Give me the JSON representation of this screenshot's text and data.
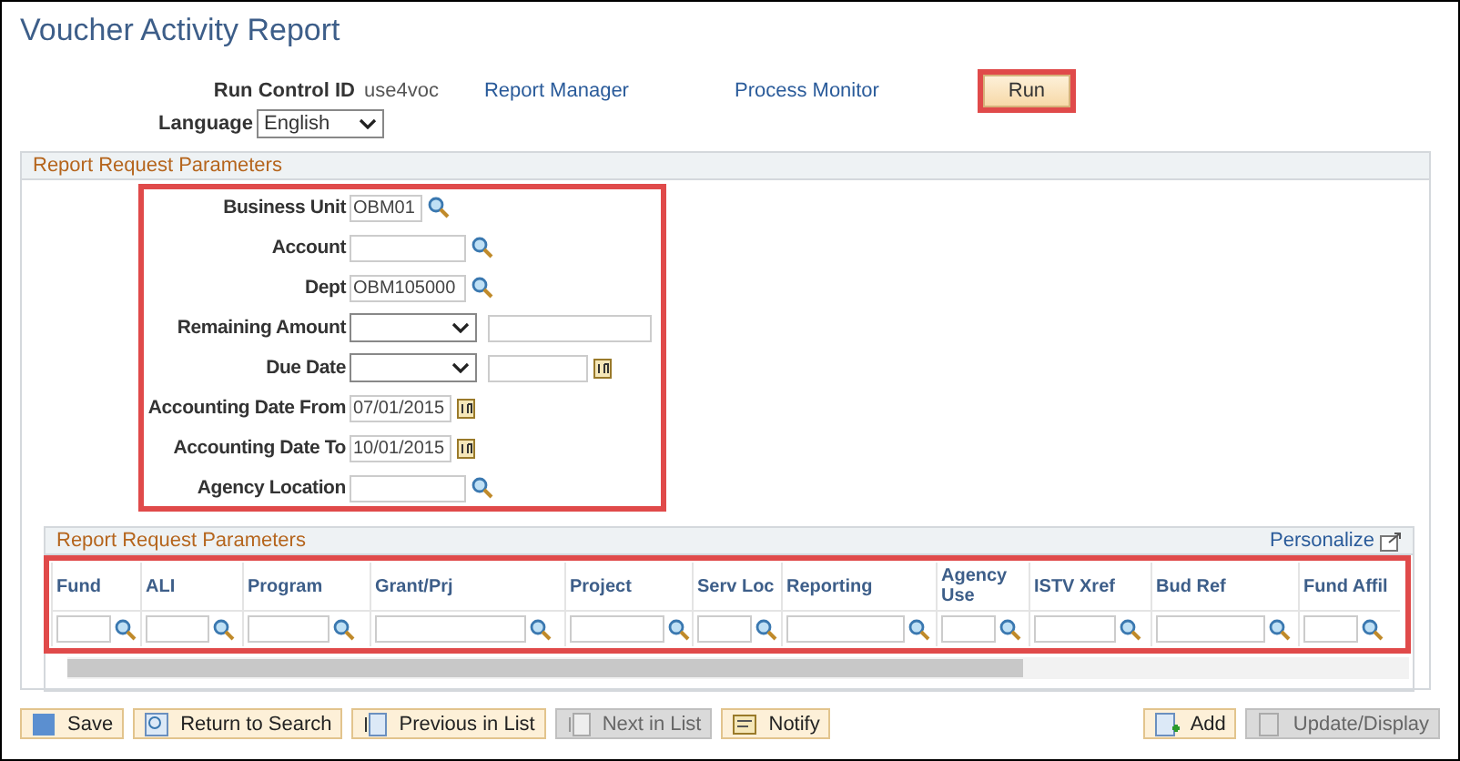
{
  "page_title": "Voucher Activity Report",
  "run_control": {
    "label": "Run Control ID",
    "value": "use4voc",
    "links": [
      "Report Manager",
      "Process Monitor"
    ],
    "run_button": {
      "label": "Run",
      "highlighted": true
    }
  },
  "language": {
    "label": "Language",
    "value": "English"
  },
  "section": {
    "title": "Report Request Parameters",
    "form": {
      "highlighted": true,
      "fields": [
        {
          "label": "Business Unit",
          "kind": "lookup",
          "value": "OBM01"
        },
        {
          "label": "Account",
          "kind": "lookup"
        },
        {
          "label": "Dept",
          "kind": "lookup",
          "value": "OBM105000"
        },
        {
          "label": "Remaining Amount",
          "kind": "select_text"
        },
        {
          "label": "Due Date",
          "kind": "select_date"
        },
        {
          "label": "Accounting Date From",
          "kind": "date",
          "value": "07/01/2015"
        },
        {
          "label": "Accounting Date To",
          "kind": "date",
          "value": "10/01/2015"
        },
        {
          "label": "Agency Location",
          "kind": "lookup"
        }
      ]
    },
    "grid": {
      "title": "Report Request Parameters",
      "personalize": "Personalize",
      "highlighted": true,
      "columns": [
        "Fund",
        "ALI",
        "Program",
        "Grant/Prj",
        "Project",
        "Serv Loc",
        "Reporting",
        "Agency Use",
        "ISTV Xref",
        "Bud Ref",
        "Fund Affil"
      ]
    }
  },
  "toolbar": {
    "left": [
      {
        "label": "Save",
        "disabled": false
      },
      {
        "label": "Return to Search",
        "disabled": false
      },
      {
        "label": "Previous in List",
        "disabled": false
      },
      {
        "label": "Next in List",
        "disabled": true
      },
      {
        "label": "Notify",
        "disabled": false
      }
    ],
    "right": [
      {
        "label": "Add",
        "disabled": false
      },
      {
        "label": "Update/Display",
        "disabled": true
      }
    ]
  }
}
